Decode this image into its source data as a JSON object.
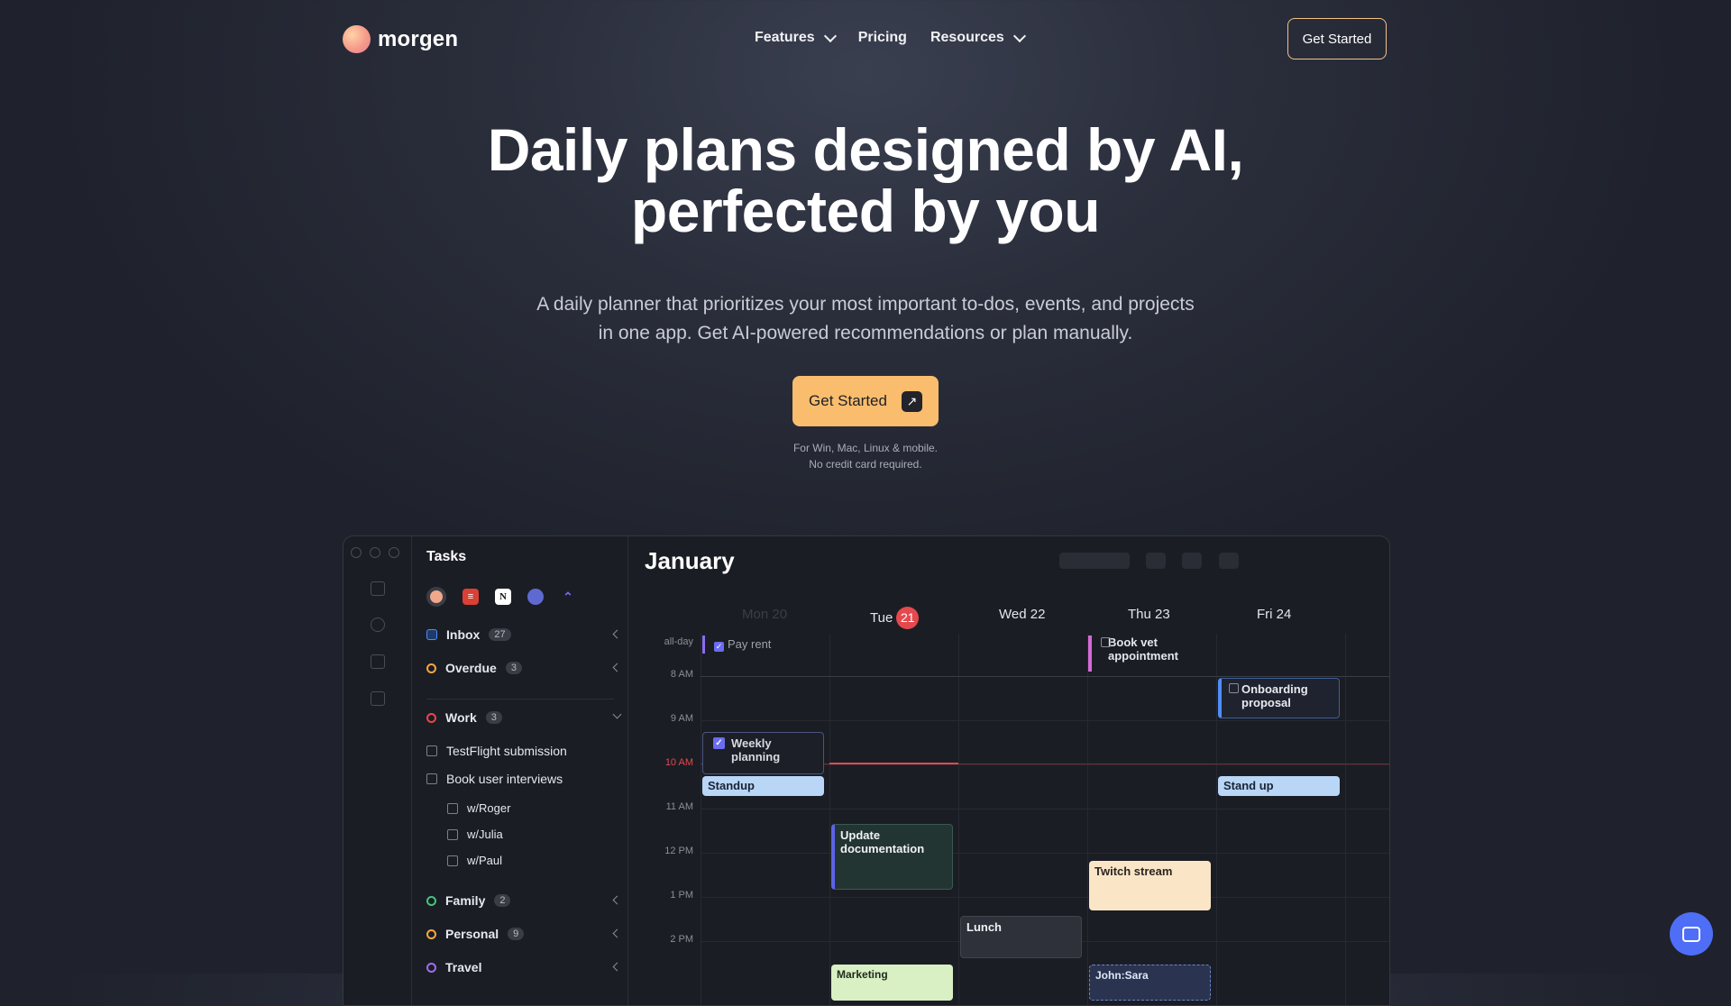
{
  "nav": {
    "logo_text": "morgen",
    "links": [
      {
        "label": "Features",
        "has_dropdown": true
      },
      {
        "label": "Pricing",
        "has_dropdown": false
      },
      {
        "label": "Resources",
        "has_dropdown": true
      }
    ],
    "cta": "Get Started"
  },
  "hero": {
    "title_line1": "Daily plans designed by AI,",
    "title_line2": "perfected by you",
    "subtitle_line1": "A daily planner that prioritizes your most important to-dos, events, and projects",
    "subtitle_line2": "in one app. Get AI-powered recommendations or plan manually.",
    "cta": "Get Started",
    "cta_icon": "arrow-up-right-icon",
    "note_line1": "For Win, Mac, Linux & mobile.",
    "note_line2": "No credit card required."
  },
  "colors": {
    "accent": "#f9bd6d",
    "today": "#e5484d",
    "now_line": "#e5484d"
  },
  "app": {
    "tasks": {
      "title": "Tasks",
      "integrations": [
        "morgen-icon",
        "todoist-icon",
        "notion-icon",
        "linear-icon",
        "clickup-icon"
      ],
      "lists": [
        {
          "label": "Inbox",
          "count": "27",
          "icon": "inbox-icon"
        },
        {
          "label": "Overdue",
          "count": "3",
          "icon": "clock-icon"
        }
      ],
      "work": {
        "label": "Work",
        "count": "3"
      },
      "work_items": [
        "TestFlight submission",
        "Book user interviews"
      ],
      "sub_items": [
        "w/Roger",
        "w/Julia",
        "w/Paul"
      ],
      "family": {
        "label": "Family",
        "count": "2"
      },
      "personal": {
        "label": "Personal",
        "count": "9"
      },
      "travel": {
        "label": "Travel"
      }
    },
    "calendar": {
      "month": "January",
      "days": [
        "Mon 20",
        "Tue",
        "Wed 22",
        "Thu 23",
        "Fri 24"
      ],
      "today_num": "21",
      "times": [
        "all-day",
        "8 AM",
        "9 AM",
        "10 AM",
        "11 AM",
        "12 PM",
        "1 PM",
        "2 PM"
      ],
      "events": {
        "pay_rent": "Pay rent",
        "book_vet": "Book vet appointment",
        "onboarding": "Onboarding proposal",
        "weekly": "Weekly planning",
        "standup": "Standup",
        "stand_up": "Stand up",
        "update_docs": "Update documentation",
        "twitch": "Twitch stream",
        "lunch": "Lunch",
        "marketing": "Marketing",
        "john_sara": "John:Sara"
      }
    }
  }
}
